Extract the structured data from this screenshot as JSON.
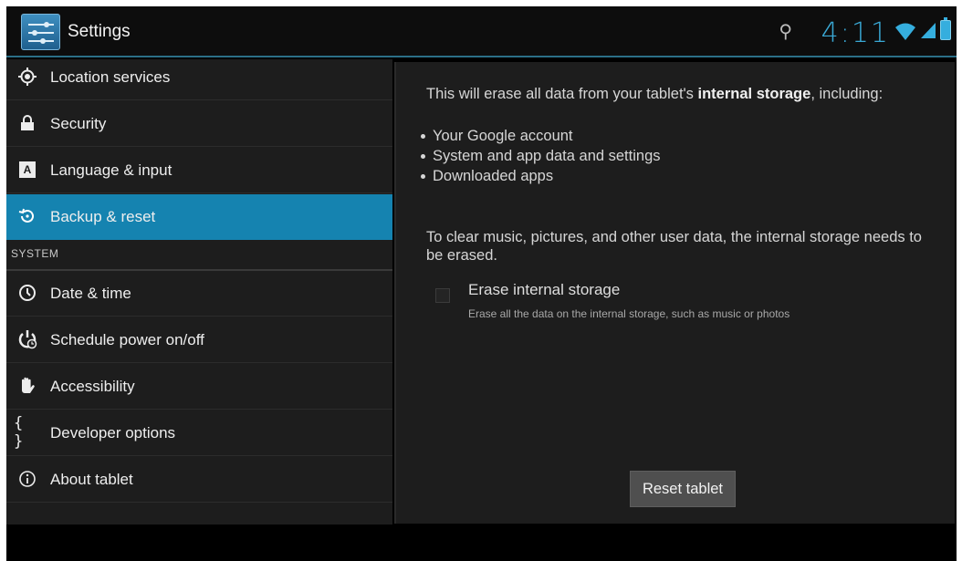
{
  "action_bar": {
    "app_title": "Settings",
    "app_icon": "settings-sliders-icon",
    "accent_color": "#2b6f87"
  },
  "status_bar": {
    "time": "4:11",
    "icons": [
      "usb-icon",
      "wifi-icon",
      "signal-icon",
      "battery-icon"
    ],
    "clock_color": "#3aa9d6"
  },
  "sidebar": {
    "active_color": "#1583b0",
    "items": [
      {
        "label": "Location services",
        "icon": "location-icon"
      },
      {
        "label": "Security",
        "icon": "lock-icon"
      },
      {
        "label": "Language & input",
        "icon": "keyboard-icon"
      },
      {
        "label": "Backup & reset",
        "icon": "backup-icon",
        "active": true
      }
    ],
    "section_header": "SYSTEM",
    "system_items": [
      {
        "label": "Date & time",
        "icon": "clock-icon"
      },
      {
        "label": "Schedule power on/off",
        "icon": "power-schedule-icon"
      },
      {
        "label": "Accessibility",
        "icon": "hand-icon"
      },
      {
        "label": "Developer options",
        "icon": "braces-icon"
      },
      {
        "label": "About tablet",
        "icon": "info-icon"
      }
    ]
  },
  "main": {
    "intro_prefix": "This will erase all data from your tablet's ",
    "intro_bold": "internal storage",
    "intro_suffix": ", including:",
    "bullets": [
      "Your Google account",
      "System and app data and settings",
      "Downloaded apps"
    ],
    "clear_text": "To clear music, pictures, and other user data, the internal storage needs to be erased.",
    "erase_option": {
      "title": "Erase internal storage",
      "subtitle": "Erase all the data on the internal storage, such as music or photos",
      "checked": false
    },
    "reset_button_label": "Reset tablet"
  }
}
